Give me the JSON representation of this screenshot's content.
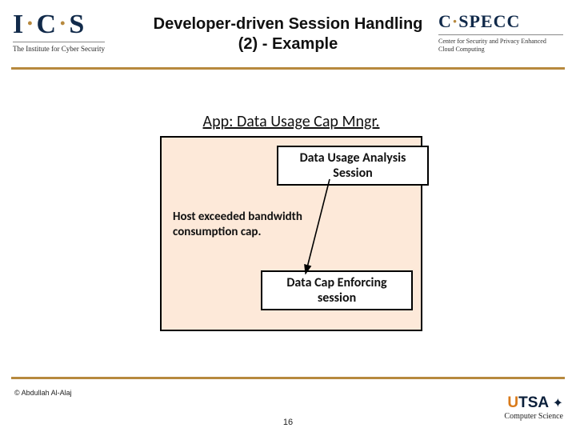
{
  "header": {
    "title": "Developer-driven Session Handling (2) - Example",
    "logo_left": {
      "letters": "I·C·S",
      "subtitle": "The Institute for Cyber Security"
    },
    "logo_right": {
      "name": "C·SPECC",
      "subtitle": "Center for Security and Privacy Enhanced Cloud Computing"
    }
  },
  "diagram": {
    "panel_title": "App: Data Usage Cap Mngr.",
    "session1": "Data Usage Analysis Session",
    "cause": "Host exceeded bandwidth consumption cap.",
    "session2": "Data Cap Enforcing session"
  },
  "footer": {
    "copyright": "© Abdullah Al-Alaj",
    "page_number": "16",
    "utsa_bold": "UTSA",
    "utsa_dept": "Computer Science"
  },
  "colors": {
    "accent_gold": "#b7893e",
    "panel_bg": "#fde9d9",
    "navy": "#112a4a"
  }
}
